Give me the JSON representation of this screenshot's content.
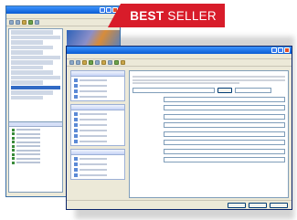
{
  "banner": {
    "word1": "BEST",
    "word2": "SELLER",
    "color": "#d81c2a"
  },
  "back_window": {
    "icon": "app-icon"
  },
  "front_window": {
    "icon": "app-icon"
  },
  "colors": {
    "titlebar": "#0a5bd3",
    "window_bg": "#ece9d8",
    "selection": "#316ac5"
  }
}
